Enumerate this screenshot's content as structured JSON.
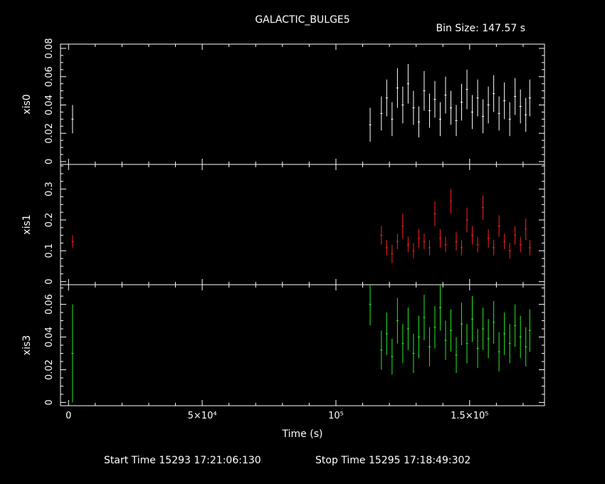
{
  "chart_data": {
    "type": "scatter",
    "title": "GALACTIC_BULGE5",
    "bin_size_label": "Bin Size: 147.57 s",
    "xlabel": "Time (s)",
    "xlim": [
      -3000,
      178000
    ],
    "x_ticks": [
      {
        "value": 0,
        "label": "0"
      },
      {
        "value": 50000,
        "label": "5×10⁴"
      },
      {
        "value": 100000,
        "label": "10⁵"
      },
      {
        "value": 150000,
        "label": "1.5×10⁵"
      }
    ],
    "footer": {
      "start_time": "Start Time 15293 17:21:06:130",
      "stop_time": "Stop Time 15295 17:18:49:302"
    },
    "panels": [
      {
        "name": "xis0",
        "color": "#ffffff",
        "ylim": [
          -0.002,
          0.083
        ],
        "y_ticks": [
          {
            "value": 0,
            "label": "0"
          },
          {
            "value": 0.02,
            "label": "0.02"
          },
          {
            "value": 0.04,
            "label": "0.04"
          },
          {
            "value": 0.06,
            "label": "0.06"
          },
          {
            "value": 0.08,
            "label": "0.08"
          }
        ],
        "points": [
          [
            1500,
            0.03,
            0.01
          ],
          [
            112800,
            0.026,
            0.012
          ],
          [
            117000,
            0.034,
            0.012
          ],
          [
            119000,
            0.045,
            0.013
          ],
          [
            121000,
            0.03,
            0.012
          ],
          [
            123000,
            0.052,
            0.014
          ],
          [
            125000,
            0.04,
            0.013
          ],
          [
            127000,
            0.055,
            0.014
          ],
          [
            129000,
            0.038,
            0.012
          ],
          [
            131000,
            0.028,
            0.011
          ],
          [
            133000,
            0.05,
            0.014
          ],
          [
            135000,
            0.036,
            0.012
          ],
          [
            137000,
            0.044,
            0.013
          ],
          [
            139000,
            0.03,
            0.012
          ],
          [
            141000,
            0.047,
            0.013
          ],
          [
            143000,
            0.038,
            0.012
          ],
          [
            145000,
            0.029,
            0.011
          ],
          [
            147000,
            0.042,
            0.013
          ],
          [
            149000,
            0.051,
            0.014
          ],
          [
            151000,
            0.035,
            0.012
          ],
          [
            153000,
            0.045,
            0.013
          ],
          [
            155000,
            0.032,
            0.012
          ],
          [
            157000,
            0.04,
            0.013
          ],
          [
            159000,
            0.048,
            0.013
          ],
          [
            161000,
            0.034,
            0.012
          ],
          [
            163000,
            0.043,
            0.013
          ],
          [
            165000,
            0.03,
            0.012
          ],
          [
            167000,
            0.046,
            0.013
          ],
          [
            169000,
            0.039,
            0.012
          ],
          [
            171000,
            0.033,
            0.012
          ],
          [
            172500,
            0.045,
            0.013
          ]
        ]
      },
      {
        "name": "xis1",
        "color": "#ff2020",
        "ylim": [
          -0.01,
          0.38
        ],
        "y_ticks": [
          {
            "value": 0,
            "label": "0"
          },
          {
            "value": 0.1,
            "label": "0.1"
          },
          {
            "value": 0.2,
            "label": "0.2"
          },
          {
            "value": 0.3,
            "label": "0.3"
          }
        ],
        "points": [
          [
            1500,
            0.13,
            0.02
          ],
          [
            117000,
            0.15,
            0.03
          ],
          [
            119000,
            0.11,
            0.025
          ],
          [
            121000,
            0.09,
            0.03
          ],
          [
            123000,
            0.13,
            0.025
          ],
          [
            125000,
            0.18,
            0.04
          ],
          [
            127000,
            0.12,
            0.025
          ],
          [
            129000,
            0.1,
            0.025
          ],
          [
            131000,
            0.14,
            0.03
          ],
          [
            133000,
            0.13,
            0.025
          ],
          [
            135000,
            0.11,
            0.025
          ],
          [
            137000,
            0.22,
            0.04
          ],
          [
            139000,
            0.14,
            0.03
          ],
          [
            141000,
            0.12,
            0.025
          ],
          [
            143000,
            0.26,
            0.04
          ],
          [
            145000,
            0.13,
            0.03
          ],
          [
            147000,
            0.11,
            0.025
          ],
          [
            149000,
            0.2,
            0.04
          ],
          [
            151000,
            0.15,
            0.03
          ],
          [
            153000,
            0.12,
            0.025
          ],
          [
            155000,
            0.24,
            0.04
          ],
          [
            157000,
            0.14,
            0.03
          ],
          [
            159000,
            0.11,
            0.025
          ],
          [
            161000,
            0.18,
            0.035
          ],
          [
            163000,
            0.13,
            0.025
          ],
          [
            165000,
            0.1,
            0.025
          ],
          [
            167000,
            0.15,
            0.03
          ],
          [
            169000,
            0.12,
            0.025
          ],
          [
            171000,
            0.17,
            0.035
          ],
          [
            172500,
            0.11,
            0.025
          ]
        ]
      },
      {
        "name": "xis3",
        "color": "#22ee22",
        "ylim": [
          -0.002,
          0.072
        ],
        "y_ticks": [
          {
            "value": 0,
            "label": "0"
          },
          {
            "value": 0.02,
            "label": "0.02"
          },
          {
            "value": 0.04,
            "label": "0.04"
          },
          {
            "value": 0.06,
            "label": "0.06"
          }
        ],
        "points": [
          [
            1500,
            0.03,
            0.03
          ],
          [
            112800,
            0.06,
            0.013
          ],
          [
            117000,
            0.032,
            0.012
          ],
          [
            119000,
            0.042,
            0.013
          ],
          [
            121000,
            0.028,
            0.011
          ],
          [
            123000,
            0.05,
            0.014
          ],
          [
            125000,
            0.036,
            0.012
          ],
          [
            127000,
            0.045,
            0.013
          ],
          [
            129000,
            0.03,
            0.012
          ],
          [
            131000,
            0.04,
            0.013
          ],
          [
            133000,
            0.052,
            0.014
          ],
          [
            135000,
            0.034,
            0.012
          ],
          [
            137000,
            0.046,
            0.013
          ],
          [
            139000,
            0.058,
            0.014
          ],
          [
            141000,
            0.038,
            0.012
          ],
          [
            143000,
            0.044,
            0.013
          ],
          [
            145000,
            0.029,
            0.011
          ],
          [
            147000,
            0.048,
            0.013
          ],
          [
            149000,
            0.036,
            0.012
          ],
          [
            151000,
            0.051,
            0.014
          ],
          [
            153000,
            0.033,
            0.012
          ],
          [
            155000,
            0.045,
            0.013
          ],
          [
            157000,
            0.039,
            0.012
          ],
          [
            159000,
            0.049,
            0.013
          ],
          [
            161000,
            0.031,
            0.012
          ],
          [
            163000,
            0.042,
            0.013
          ],
          [
            165000,
            0.036,
            0.012
          ],
          [
            167000,
            0.047,
            0.013
          ],
          [
            169000,
            0.04,
            0.013
          ],
          [
            171000,
            0.034,
            0.012
          ],
          [
            172500,
            0.044,
            0.013
          ]
        ]
      }
    ]
  }
}
